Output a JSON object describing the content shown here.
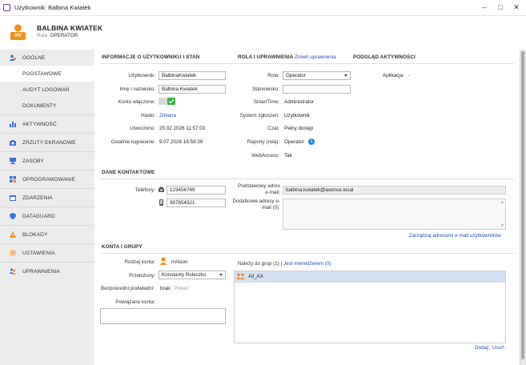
{
  "window": {
    "title": "Użytkownik: Balbina Kwiatek"
  },
  "user": {
    "initials": "NV",
    "name": "BALBINA KWIATEK",
    "role_label": "Rola:",
    "role_value": "OPERATOR"
  },
  "sidebar": {
    "items": [
      {
        "label": "OGÓLNE"
      },
      {
        "label": "PODSTAWOWE"
      },
      {
        "label": "AUDYT LOGOWAŃ"
      },
      {
        "label": "DOKUMENTY"
      },
      {
        "label": "AKTYWNOŚĆ"
      },
      {
        "label": "ZRZUTY EKRANOWE"
      },
      {
        "label": "ZASOBY"
      },
      {
        "label": "OPROGRAMOWANIE"
      },
      {
        "label": "ZDARZENIA"
      },
      {
        "label": "DATAGUARD"
      },
      {
        "label": "BLOKADY"
      },
      {
        "label": "USTAWIENIA"
      },
      {
        "label": "UPRAWNIENIA"
      }
    ]
  },
  "info": {
    "title": "INFORMACJE O UŻYTKOWNIKU I STAN",
    "username_label": "Użytkownik:",
    "username_value": "BalbinaKwiatek",
    "fullname_label": "Imię i nazwisko:",
    "fullname_value": "Balbina Kwiatek",
    "enabled_label": "Konto włączone:",
    "password_label": "Hasło:",
    "password_link": "Zmiana",
    "created_label": "Utworzono:",
    "created_value": "25.02.2026 11:57:03",
    "lastlogin_label": "Ostatnie logowanie:",
    "lastlogin_value": "9.07.2026 16:59:39"
  },
  "roles": {
    "title": "ROLA I UPRAWNIENIA",
    "change_link": "Zmień uprawnenia",
    "role_label": "Rola:",
    "role_value": "Operator",
    "position_label": "Stanowisko:",
    "position_value": "",
    "smarttime_label": "SmartTime:",
    "smarttime_value": "Administrator",
    "system_label": "System zgłoszeń:",
    "system_value": "Użytkownik",
    "chat_label": "Czat:",
    "chat_value": "Pełny dostęp",
    "reports_label": "Raporty (rola):",
    "reports_value": "Operator",
    "webaccess_label": "WebAccess:",
    "webaccess_value": "Tak"
  },
  "activity": {
    "title": "PODGLĄD AKTYWNOŚCI",
    "app_label": "Aplikacja:",
    "app_value": "-"
  },
  "contact": {
    "title": "DANE KONTAKTOWE",
    "phones_label": "Telefony:",
    "phone1": "123456789",
    "phone2": "987654321",
    "email_label": "Podstawowy adres e-mail:",
    "email_value": "balbina.kwiatek@axence.local",
    "extra_email_label": "Dodatkowe adresy e-mail (0):",
    "manage_link": "Zarządzaj adresami e-mail użytkowników"
  },
  "accounts": {
    "title": "KONTA I GRUPY",
    "account_type_label": "Rodzaj konta:",
    "account_type_value": "nVision",
    "supervisor_label": "Przełożony:",
    "supervisor_value": "Konstanty Roleczko",
    "subordinates_label": "Bezpośredni podwładni:",
    "subordinates_value": "brak",
    "subordinates_show": "Pokaż",
    "linked_label": "Powiązane konta:",
    "groups_prefix": "Należy do grup (1) |",
    "groups_manager_link": "Jest menedżerem (0)",
    "groups": [
      "All_AX"
    ],
    "add_link": "Dodaj",
    "sep": "|",
    "remove_link": "Usuń"
  },
  "colors": {
    "accent": "#1e4fc1",
    "avatar": "#f0901a",
    "toggle_on": "#3cb043"
  }
}
